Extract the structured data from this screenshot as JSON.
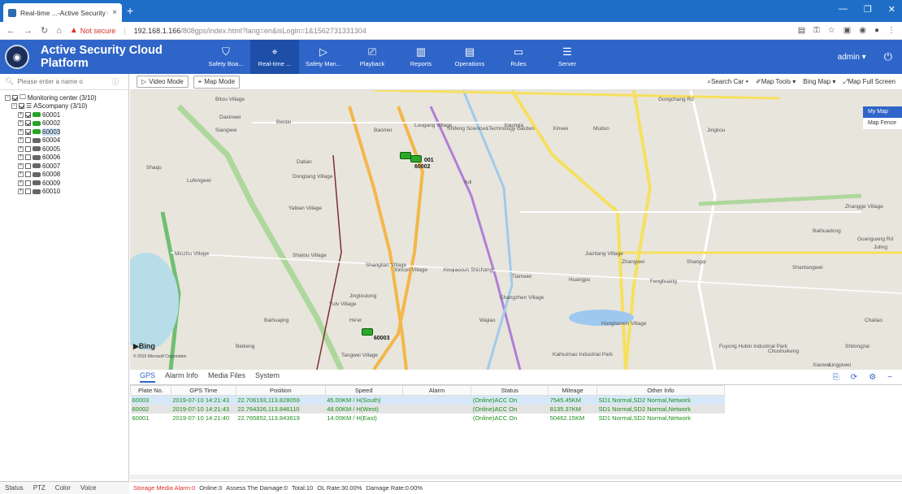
{
  "browser": {
    "tab_title": "Real-time ...-Active Security Cl",
    "tab_close": "×",
    "new_tab": "+",
    "security_warning": "Not secure",
    "url_host": "192.168.1.166",
    "url_path": "/808gps/index.html?lang=en&isLogin=1&1562731331304"
  },
  "app": {
    "title": "Active Security Cloud Platform",
    "modules": [
      {
        "label": "Safety Boa...",
        "icon": "shield-icon"
      },
      {
        "label": "Real-time ...",
        "icon": "location-pin-icon"
      },
      {
        "label": "Safety Man...",
        "icon": "play-circle-icon"
      },
      {
        "label": "Playback",
        "icon": "playback-icon"
      },
      {
        "label": "Reports",
        "icon": "bar-chart-icon"
      },
      {
        "label": "Operations",
        "icon": "document-icon"
      },
      {
        "label": "Rules",
        "icon": "window-icon"
      },
      {
        "label": "Server",
        "icon": "sliders-icon"
      }
    ],
    "active_module": 1,
    "user": "admin"
  },
  "sidebar": {
    "search_placeholder": "Please enter a name o",
    "tree": {
      "root": "Monitoring center (3/10)",
      "company": "AScompany (3/10)",
      "vehicles": [
        {
          "id": "60001",
          "online": true,
          "checked": true
        },
        {
          "id": "60002",
          "online": true,
          "checked": true
        },
        {
          "id": "60003",
          "online": true,
          "checked": true,
          "selected": true
        },
        {
          "id": "60004",
          "online": false,
          "checked": false
        },
        {
          "id": "60005",
          "online": false,
          "checked": false
        },
        {
          "id": "60006",
          "online": false,
          "checked": false
        },
        {
          "id": "60007",
          "online": false,
          "checked": false
        },
        {
          "id": "60008",
          "online": false,
          "checked": false
        },
        {
          "id": "60009",
          "online": false,
          "checked": false
        },
        {
          "id": "60010",
          "online": false,
          "checked": false
        }
      ]
    },
    "footer_tabs": [
      "Status",
      "PTZ",
      "Color",
      "Voice"
    ]
  },
  "map_toolbar": {
    "video_mode": "Video Mode",
    "map_mode": "Map Mode",
    "search_car": "Search Car",
    "map_tools": "Map Tools",
    "bing_map": "Bing Map",
    "full_screen": "Map Full Screen"
  },
  "map": {
    "types": [
      "My Map",
      "Map Fence"
    ],
    "attribution": "Bing",
    "copyright": "© 2019 Microsoft Corporation",
    "places": [
      "Bitou Village",
      "Daxinwei",
      "Beidai",
      "Siangwei",
      "Shaqu",
      "Lufengwei",
      "Datian",
      "Dongtang Village",
      "Baomei",
      "Lougang Village",
      "Shifeng Science&Technology Garden",
      "Xiashijia",
      "Xinwei",
      "Mudun",
      "Gongchang Rd",
      "Jingkou",
      "Zhangge Village",
      "Yuli",
      "Minzhu Village",
      "Yabian Village",
      "Shatou Village",
      "Xincun Village",
      "Shanglian Village",
      "Xinqiaocun Shichang",
      "Tianwan",
      "Jiazitang Village",
      "Zhangwei",
      "Shangqi",
      "Baihuadong",
      "Guanguang Rd",
      "Juling",
      "Fenghuang",
      "Shantangwei",
      "Jingtoulong",
      "Huangpu",
      "Changzhen Village",
      "Yulv Village",
      "He'er",
      "Wajiao",
      "Hongtianxin Village",
      "Baihuajing",
      "Beikeng",
      "Tangwei Village",
      "Kaihuimao Industrial Park",
      "Fuyong Hubin Industrial Park",
      "Chushuikeng",
      "Shilongzai",
      "Chaliao",
      "Xianwei",
      "Lingpiwei"
    ],
    "vehicle_labels": [
      "001",
      "60002",
      "60003"
    ]
  },
  "bottom_tabs": [
    "GPS",
    "Alarm Info",
    "Media Files",
    "System"
  ],
  "grid": {
    "columns": [
      "Plate No.",
      "GPS Time",
      "Position",
      "Speed",
      "Alarm",
      "Status",
      "Mileage",
      "Other Info"
    ],
    "rows": [
      [
        "60003",
        "2019-07-10 14:21:43",
        "22.706193,113.828059",
        "45.00KM / H(South)",
        "",
        "(Online)ACC On",
        "7545.45KM",
        "SD1 Normal,SD2 Normal,Network"
      ],
      [
        "60002",
        "2019-07-10 14:21:43",
        "22.764326,113.846110",
        "48.00KM / H(West)",
        "",
        "(Online)ACC On",
        "8135.37KM",
        "SD1 Normal,SD2 Normal,Network"
      ],
      [
        "60001",
        "2019-07-10 14:21:40",
        "22.765852,113.843619",
        "14.00KM / H(East)",
        "",
        "(Online)ACC On",
        "50462.15KM",
        "SD1 Normal,SD2 Normal,Network"
      ]
    ]
  },
  "statusbar": {
    "alarm": "Storage Media Alarm:0",
    "online": "Online:3",
    "damage": "Assess The Damage:0",
    "total": "Total:10",
    "ol_rate": "OL Rate:30.00%",
    "damage_rate": "Damage Rate:0.00%"
  },
  "colors": {
    "header_blue": "#2f65c8",
    "online_green": "#1c8f1c",
    "alarm_red": "#d93025"
  }
}
